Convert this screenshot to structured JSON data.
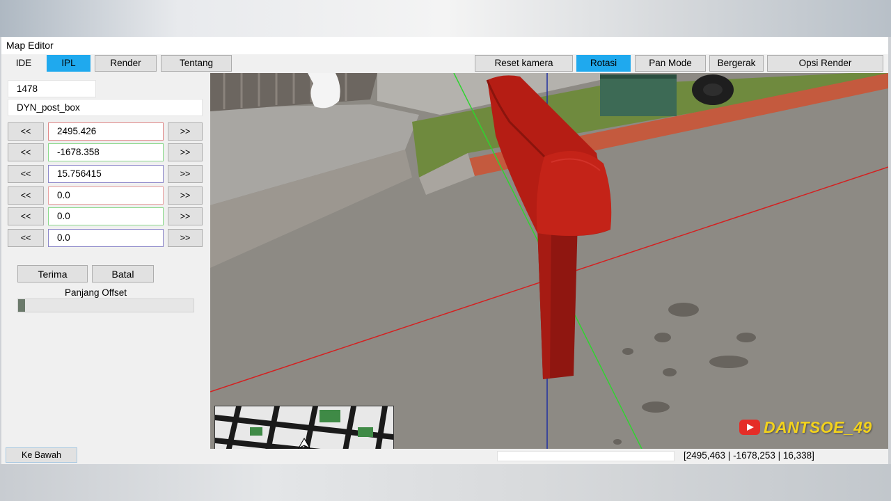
{
  "window": {
    "title": "Map Editor"
  },
  "tabs": [
    {
      "label": "IDE",
      "active": false
    },
    {
      "label": "IPL",
      "active": true
    },
    {
      "label": "Render",
      "active": false
    },
    {
      "label": "Tentang",
      "active": false
    }
  ],
  "toolbar": {
    "reset_camera": "Reset kamera",
    "rotate": "Rotasi",
    "pan_mode": "Pan Mode",
    "move": "Bergerak",
    "render_options": "Opsi Render",
    "active_tool": "Rotasi"
  },
  "object": {
    "id": "1478",
    "name": "DYN_post_box"
  },
  "transform": {
    "prev_label": "<<",
    "next_label": ">>",
    "rows": [
      {
        "value": "2495.426"
      },
      {
        "value": "-1678.358"
      },
      {
        "value": "15.756415"
      },
      {
        "value": "0.0"
      },
      {
        "value": "0.0"
      },
      {
        "value": "0.0"
      }
    ]
  },
  "actions": {
    "accept": "Terima",
    "cancel": "Batal"
  },
  "offset": {
    "label": "Panjang Offset",
    "fraction": 0.04
  },
  "footer": {
    "move_down": "Ke Bawah",
    "camera_coords": "[2495,463 | -1678,253 | 16,338]"
  },
  "watermark": {
    "text": "DANTSOE_49"
  },
  "colors": {
    "accent": "#1fa9ee",
    "axis_x": "#d42020",
    "axis_y": "#2fd42f",
    "axis_z": "#2030a0",
    "mailbox": "#b51d14",
    "watermark": "#f2d21d"
  }
}
